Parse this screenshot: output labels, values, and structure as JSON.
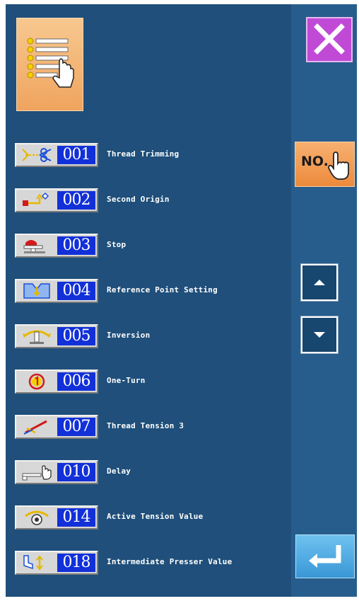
{
  "header": {
    "menu_icon": "list-hand-icon",
    "close_icon": "close-x-icon"
  },
  "items": [
    {
      "code": "001",
      "label": "Thread Trimming",
      "icon": "scissors-icon"
    },
    {
      "code": "002",
      "label": "Second Origin",
      "icon": "second-origin-icon"
    },
    {
      "code": "003",
      "label": "Stop",
      "icon": "machine-stop-icon"
    },
    {
      "code": "004",
      "label": "Reference Point Setting",
      "icon": "reference-point-icon"
    },
    {
      "code": "005",
      "label": "Inversion",
      "icon": "inversion-icon"
    },
    {
      "code": "006",
      "label": "One-Turn",
      "icon": "one-turn-icon"
    },
    {
      "code": "007",
      "label": "Thread Tension 3",
      "icon": "thread-tension-icon"
    },
    {
      "code": "010",
      "label": "Delay",
      "icon": "delay-hand-icon"
    },
    {
      "code": "014",
      "label": "Active Tension Value",
      "icon": "active-tension-icon"
    },
    {
      "code": "018",
      "label": "Intermediate Presser Value",
      "icon": "presser-icon"
    }
  ],
  "sidebar": {
    "no_label": "NO.",
    "up_icon": "arrow-up-icon",
    "down_icon": "arrow-down-icon",
    "enter_icon": "enter-return-icon"
  },
  "colors": {
    "background": "#1f4f7a",
    "code_box": "#1230d8",
    "menu_button": "#f0a45e",
    "close_button": "#c04ad6",
    "enter_button": "#3a97d6"
  }
}
